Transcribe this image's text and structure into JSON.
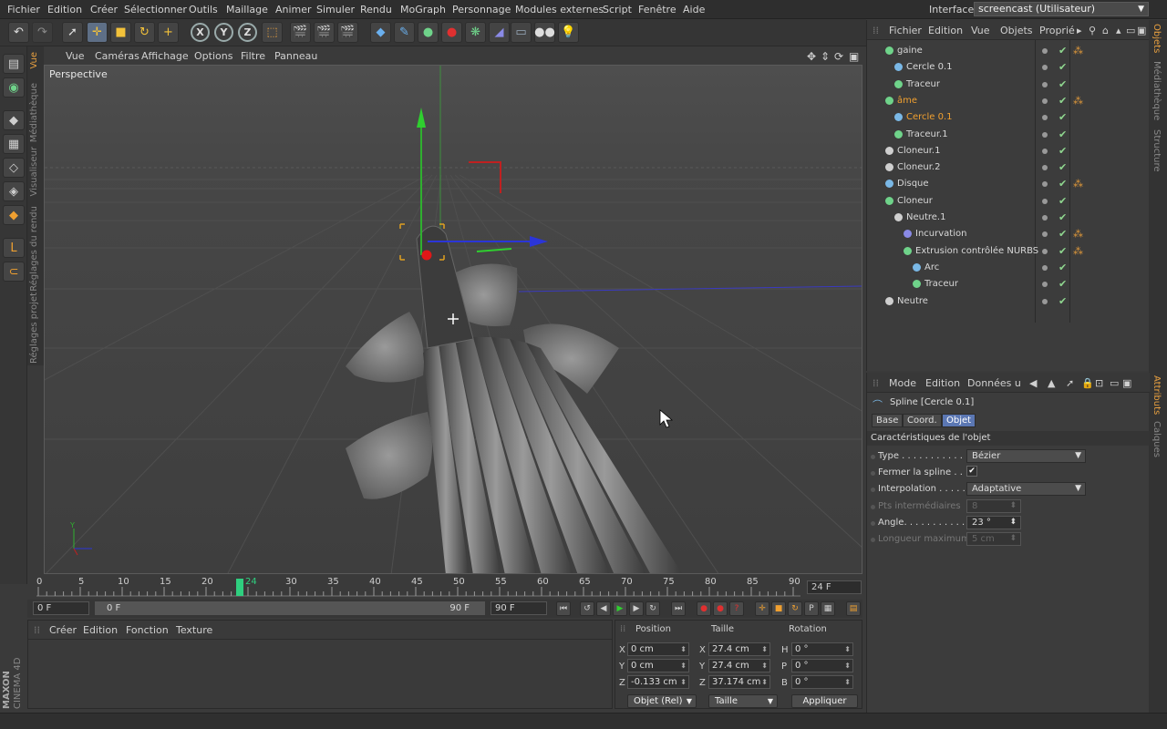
{
  "menubar": {
    "items": [
      "Fichier",
      "Edition",
      "Créer",
      "Sélectionner",
      "Outils",
      "Maillage",
      "Animer",
      "Simuler",
      "Rendu",
      "MoGraph",
      "Personnage",
      "Modules externes",
      "Script",
      "Fenêtre",
      "Aide"
    ],
    "interface_label": "Interface:",
    "interface_value": "screencast (Utilisateur)"
  },
  "toolbar": {
    "icons": [
      "undo-icon",
      "redo-icon",
      "live-select-icon",
      "move-icon",
      "scale-icon",
      "rotate-icon",
      "add-icon",
      "x-axis",
      "y-axis",
      "z-axis",
      "coordinate-system-icon",
      "render-view-icon",
      "render-picture-viewer-icon",
      "edit-render-settings-icon",
      "cube-icon",
      "spline-pen-icon",
      "nurbs-icon",
      "array-icon",
      "deformer-icon",
      "scene-icon",
      "camera-icon",
      "light-icon"
    ],
    "axis_x": "X",
    "axis_y": "Y",
    "axis_z": "Z"
  },
  "left_tabs": [
    "Vue",
    "Médiathèque",
    "Visualiseur",
    "Réglages du rendu",
    "Réglages projet"
  ],
  "viewport": {
    "menu": [
      "Vue",
      "Caméras",
      "Affichage",
      "Options",
      "Filtre",
      "Panneau"
    ],
    "label": "Perspective"
  },
  "timeline": {
    "ticks": [
      "0",
      "5",
      "10",
      "15",
      "20",
      "24",
      "30",
      "35",
      "40",
      "45",
      "50",
      "55",
      "60",
      "65",
      "70",
      "75",
      "80",
      "85",
      "90"
    ],
    "current_frame": "24",
    "frame_display": "24 F",
    "start_field": "0 F",
    "range_start": "0 F",
    "range_end": "90 F",
    "end_field": "90 F"
  },
  "material_panel": {
    "menu": [
      "Créer",
      "Edition",
      "Fonction",
      "Texture"
    ]
  },
  "coord_panel": {
    "headers": [
      "Position",
      "Taille",
      "Rotation"
    ],
    "pos": [
      {
        "axis": "X",
        "value": "0 cm"
      },
      {
        "axis": "Y",
        "value": "0 cm"
      },
      {
        "axis": "Z",
        "value": "-0.133 cm"
      }
    ],
    "size": [
      {
        "axis": "X",
        "value": "27.4 cm"
      },
      {
        "axis": "Y",
        "value": "27.4 cm"
      },
      {
        "axis": "Z",
        "value": "37.174 cm"
      }
    ],
    "rot": [
      {
        "axis": "H",
        "value": "0 °"
      },
      {
        "axis": "P",
        "value": "0 °"
      },
      {
        "axis": "B",
        "value": "0 °"
      }
    ],
    "mode_select": "Objet (Rel)",
    "size_select": "Taille",
    "apply": "Appliquer"
  },
  "object_panel": {
    "menu": [
      "Fichier",
      "Edition",
      "Vue",
      "Objets",
      "Proprié"
    ],
    "objects": [
      {
        "name": "gaine",
        "indent": 0,
        "sel": false,
        "color": "#6fd38a",
        "tag": true
      },
      {
        "name": "Cercle 0.1",
        "indent": 1,
        "sel": false,
        "color": "#7ab8e6",
        "tag": false
      },
      {
        "name": "Traceur",
        "indent": 1,
        "sel": false,
        "color": "#6fd38a",
        "tag": false
      },
      {
        "name": "âme",
        "indent": 0,
        "sel": true,
        "color": "#6fd38a",
        "tag": true
      },
      {
        "name": "Cercle 0.1",
        "indent": 1,
        "sel": true,
        "color": "#7ab8e6",
        "tag": false
      },
      {
        "name": "Traceur.1",
        "indent": 1,
        "sel": false,
        "color": "#6fd38a",
        "tag": false
      },
      {
        "name": "Cloneur.1",
        "indent": 0,
        "sel": false,
        "color": "#cfcfcf",
        "tag": false
      },
      {
        "name": "Cloneur.2",
        "indent": 0,
        "sel": false,
        "color": "#cfcfcf",
        "tag": false
      },
      {
        "name": "Disque",
        "indent": 0,
        "sel": false,
        "color": "#7ab8e6",
        "tag": true
      },
      {
        "name": "Cloneur",
        "indent": 0,
        "sel": false,
        "color": "#6fd38a",
        "tag": false
      },
      {
        "name": "Neutre.1",
        "indent": 1,
        "sel": false,
        "color": "#cfcfcf",
        "tag": false
      },
      {
        "name": "Incurvation",
        "indent": 2,
        "sel": false,
        "color": "#8a8ae6",
        "tag": true
      },
      {
        "name": "Extrusion contrôlée NURBS",
        "indent": 2,
        "sel": false,
        "color": "#6fd38a",
        "tag": true
      },
      {
        "name": "Arc",
        "indent": 3,
        "sel": false,
        "color": "#7ab8e6",
        "tag": false
      },
      {
        "name": "Traceur",
        "indent": 3,
        "sel": false,
        "color": "#6fd38a",
        "tag": false
      },
      {
        "name": "Neutre",
        "indent": 0,
        "sel": false,
        "color": "#cfcfcf",
        "tag": false
      }
    ]
  },
  "right_tabs_top": [
    "Objets",
    "Médiathèque",
    "Structure"
  ],
  "right_tabs_bottom": [
    "Attributs",
    "Calques"
  ],
  "attr_panel": {
    "menu": [
      "Mode",
      "Edition",
      "Données u"
    ],
    "object_title": "Spline [Cercle 0.1]",
    "tabs": [
      "Base",
      "Coord.",
      "Objet"
    ],
    "active_tab": "Objet",
    "section": "Caractéristiques de l'objet",
    "rows": [
      {
        "label": "Type . . . . . . . . . . . . . .",
        "value": "Bézier",
        "kind": "select",
        "dim": false
      },
      {
        "label": "Fermer la spline . . .",
        "value": "✔",
        "kind": "check",
        "dim": false
      },
      {
        "label": "Interpolation . . . . . .",
        "value": "Adaptative",
        "kind": "select",
        "dim": false
      },
      {
        "label": "Pts intermédiaires",
        "value": "8",
        "kind": "num",
        "dim": true
      },
      {
        "label": "Angle. . . . . . . . . . . . .",
        "value": "23 °",
        "kind": "num",
        "dim": false
      },
      {
        "label": "Longueur maximum",
        "value": "5 cm",
        "kind": "num",
        "dim": true
      }
    ]
  },
  "branding": {
    "maxon": "MAXON",
    "cinema": "CINEMA 4D"
  },
  "colors": {
    "accent": "#5b77b3",
    "selected": "#f0a030",
    "check": "#8fd68f"
  }
}
